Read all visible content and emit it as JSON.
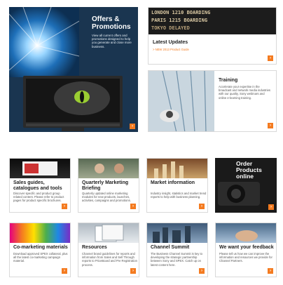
{
  "offers": {
    "title": "Offers & Promotions",
    "desc": "View all current offers and promotions designed to help you generate and close more business."
  },
  "updates": {
    "board_lines": [
      "LONDON  1210 BOARDING",
      "PARIS   1215 BOARDING",
      "TOKYO        DELAYED"
    ],
    "title": "Latest Updates",
    "link": "> NEW 2013 Product Guide"
  },
  "training": {
    "title": "Training",
    "desc": "Accelerate your expertise in the broadcast and network media industries with our quality, Sony webinars and online e-learning training."
  },
  "tiles_row1": [
    {
      "title": "Sales guides, catalogues and tools",
      "desc": "Discover specific and product group related content. Please refer to product pages for product specific brochures."
    },
    {
      "title": "Quarterly Marketing Briefing",
      "desc": "Quarterly updated online marketing modules for new products, launches, activities, campaigns and promotions."
    },
    {
      "title": "Market information",
      "desc": "Industry insight, statistics and market trend reports to help with business planning."
    },
    {
      "title": "Order Products online",
      "desc": ""
    }
  ],
  "tiles_row2": [
    {
      "title": "Co-marketing materials",
      "desc": "Download approved SPEX collateral, plus all the latest co-marketing campaign material."
    },
    {
      "title": "Resources",
      "desc": "Channel brand guidelines for reports and information from Sales and Sell Through reports to PriceBoard and Pre Registration process."
    },
    {
      "title": "Channel Summit",
      "desc": "The Business Channel Summit is key to developing the strategic partnership between Sony and SPEX. Catch up on latest content here."
    },
    {
      "title": "We want your feedback",
      "desc": "Please tell us how we can improve the information and resources we provide for Channel Partners."
    }
  ],
  "arrow": "›",
  "colors": {
    "accent": "#f47b20",
    "offers_bg": "#1a3550"
  }
}
